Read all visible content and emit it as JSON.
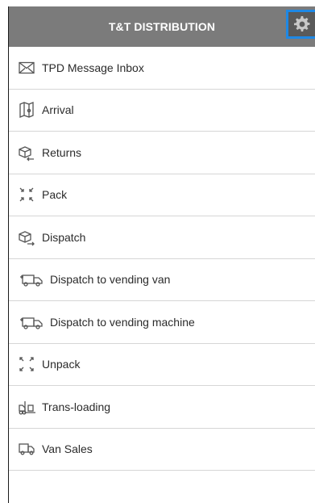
{
  "header": {
    "title": "T&T DISTRIBUTION",
    "settings_icon": "gear-icon"
  },
  "menu": {
    "items": [
      {
        "label": "TPD Message Inbox",
        "icon": "envelope-icon"
      },
      {
        "label": "Arrival",
        "icon": "map-icon"
      },
      {
        "label": "Returns",
        "icon": "box-return-icon"
      },
      {
        "label": "Pack",
        "icon": "pack-arrows-icon"
      },
      {
        "label": "Dispatch",
        "icon": "box-dispatch-icon"
      },
      {
        "label": "Dispatch to vending van",
        "icon": "van-dispatch-icon"
      },
      {
        "label": "Dispatch to vending machine",
        "icon": "van-dispatch-icon"
      },
      {
        "label": "Unpack",
        "icon": "unpack-arrows-icon"
      },
      {
        "label": "Trans-loading",
        "icon": "trans-loading-icon"
      },
      {
        "label": "Van Sales",
        "icon": "truck-icon"
      }
    ]
  },
  "colors": {
    "header_bg": "#7b7b7b",
    "settings_border": "#1e88e5"
  }
}
